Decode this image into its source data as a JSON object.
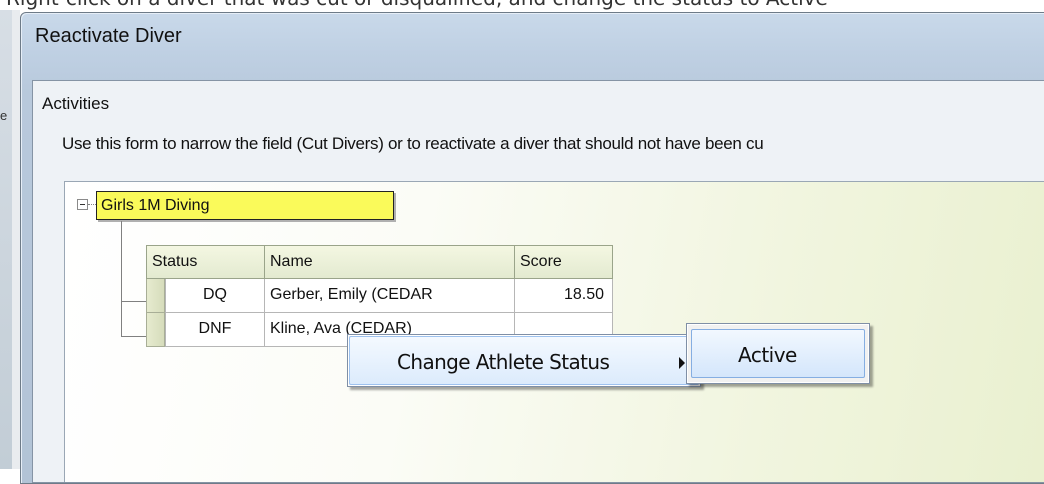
{
  "top_caption": "Right-click on a diver that was cut or disqualified, and change the status to Active",
  "background_window": {
    "letter": "e"
  },
  "dialog": {
    "title": "Reactivate Diver",
    "group_label": "Activities",
    "instruction": "Use this form to narrow the field (Cut Divers) or to reactivate a diver that should not have been cu"
  },
  "tree": {
    "event_node": "Girls 1M Diving",
    "columns": [
      "Status",
      "Name",
      "Score"
    ],
    "rows": [
      {
        "status": "DQ",
        "name": "Gerber, Emily (CEDAR",
        "score": "18.50"
      },
      {
        "status": "DNF",
        "name": "Kline, Ava (CEDAR)",
        "score": ""
      }
    ]
  },
  "context_menu": {
    "item": "Change Athlete Status",
    "submenu": [
      "Active"
    ]
  },
  "colors": {
    "event_node_highlight": "#fafa5a",
    "menu_hover": "#dcebfc"
  }
}
